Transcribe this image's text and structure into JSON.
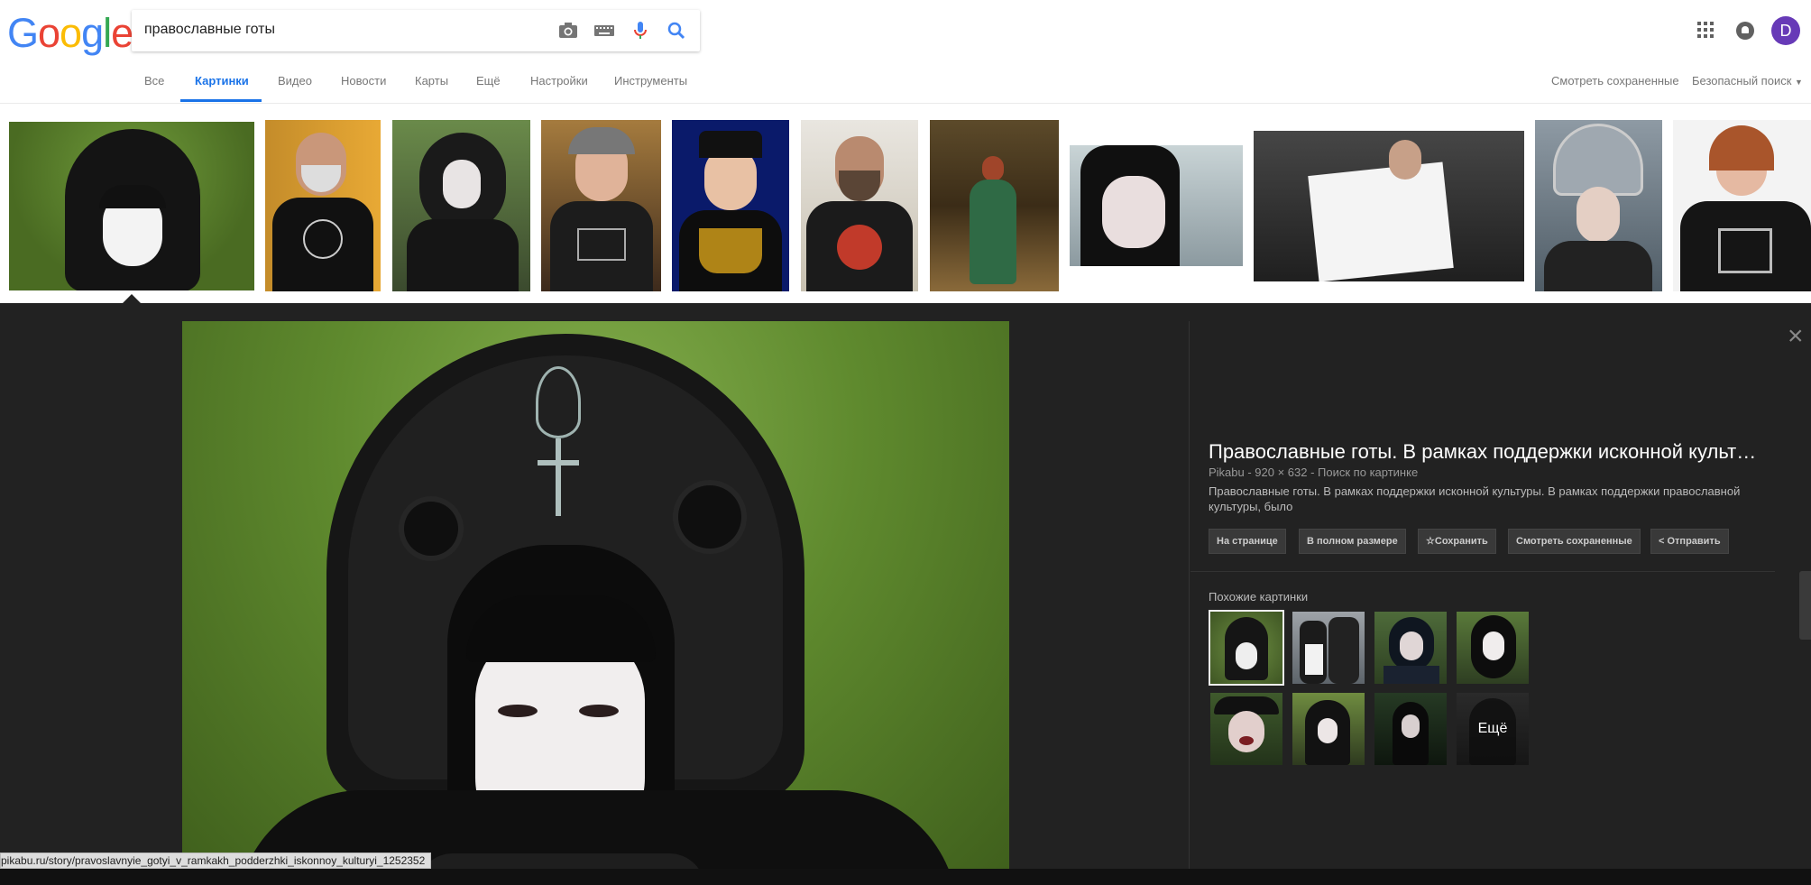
{
  "logo": {
    "letters": [
      "G",
      "o",
      "o",
      "g",
      "l",
      "e"
    ],
    "colors": [
      "#4285f4",
      "#ea4335",
      "#fbbc05",
      "#4285f4",
      "#34a853",
      "#ea4335"
    ]
  },
  "search": {
    "query": "православные готы"
  },
  "header_right": {
    "avatar_letter": "D"
  },
  "tabs": [
    {
      "label": "Все"
    },
    {
      "label": "Картинки",
      "active": true
    },
    {
      "label": "Видео"
    },
    {
      "label": "Новости"
    },
    {
      "label": "Карты"
    },
    {
      "label": "Ещё"
    },
    {
      "label": "Настройки"
    },
    {
      "label": "Инструменты"
    }
  ],
  "tools_right": {
    "saved": "Смотреть сохраненные",
    "safe_search": "Безопасный поиск"
  },
  "viewer": {
    "title": "Православные готы. В рамках поддержки исконной культ…",
    "meta": "Pikabu - 920 × 632 - Поиск по картинке",
    "description": "Православные готы. В рамках поддержки исконной культуры. В рамках поддержки православной культуры, было",
    "actions": [
      "На странице",
      "В полном размере",
      "Сохранить",
      "Смотреть сохраненные",
      "Отправить"
    ],
    "similar_label": "Похожие картинки",
    "more_label": "Ещё"
  },
  "status_url": "pikabu.ru/story/pravoslavnyie_gotyi_v_ramkakh_podderzhki_iskonnoy_kulturyi_1252352",
  "colors": {
    "accent": "#1a73e8",
    "viewer_bg": "#222222"
  }
}
